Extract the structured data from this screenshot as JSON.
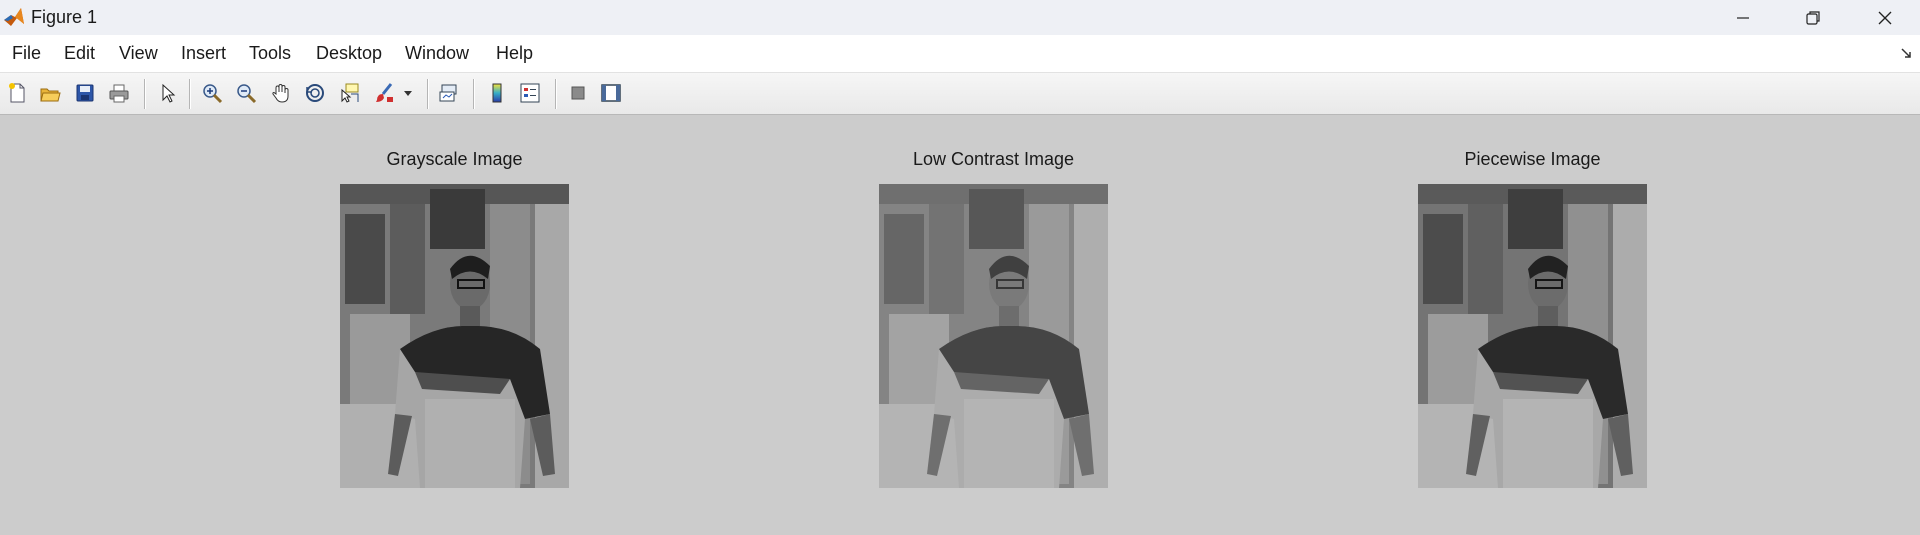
{
  "window": {
    "title": "Figure 1"
  },
  "menu": {
    "items": [
      "File",
      "Edit",
      "View",
      "Insert",
      "Tools",
      "Desktop",
      "Window",
      "Help"
    ]
  },
  "toolbar": {
    "buttons": [
      "new-figure-icon",
      "open-file-icon",
      "save-icon",
      "print-icon",
      "edit-plot-arrow-icon",
      "zoom-in-icon",
      "zoom-out-icon",
      "pan-hand-icon",
      "rotate-3d-icon",
      "data-cursor-icon",
      "brush-icon",
      "brush-dropdown-icon",
      "link-plot-icon",
      "insert-colorbar-icon",
      "insert-legend-icon",
      "hide-plot-tools-icon",
      "show-plot-tools-icon"
    ]
  },
  "axes": [
    {
      "title": "Grayscale Image",
      "tone": "normal"
    },
    {
      "title": "Low Contrast Image",
      "tone": "low"
    },
    {
      "title": "Piecewise Image",
      "tone": "normal"
    }
  ],
  "colors": {
    "figure_bg": "#cccccc",
    "menu_bg": "#ffffff",
    "title_bg": "#eef0f5"
  }
}
